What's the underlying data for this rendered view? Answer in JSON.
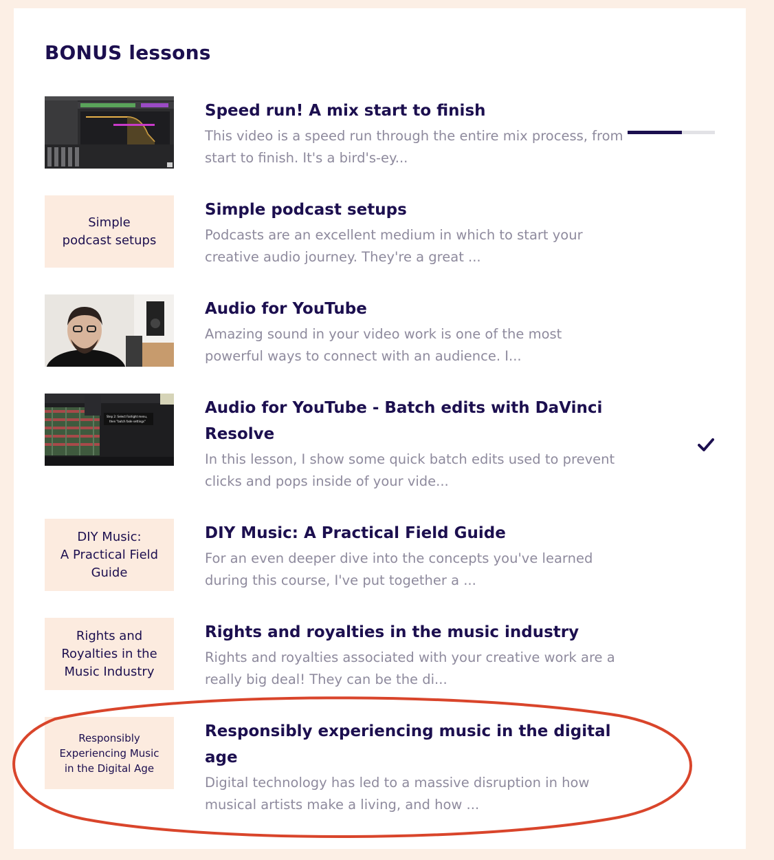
{
  "section": {
    "title": "BONUS lessons"
  },
  "lessons": [
    {
      "title": "Speed run! A mix start to finish",
      "description": "This video is a speed run through the entire mix process, from start to finish.  It's a bird's-ey...",
      "thumbnail_type": "daw-screenshot",
      "progress": 0.62
    },
    {
      "title": "Simple podcast setups",
      "description": "Podcasts are an excellent medium in which to start your creative audio journey.  They're a great ...",
      "thumbnail_text": "Simple\npodcast setups"
    },
    {
      "title": "Audio for YouTube",
      "description": "Amazing sound in your video work is one of the most powerful ways to connect with an audience.  I...",
      "thumbnail_type": "webcam-photo"
    },
    {
      "title": "Audio for YouTube - Batch edits with DaVinci Resolve",
      "description": "In this lesson, I show some quick batch edits used to prevent clicks and pops inside of your vide...",
      "thumbnail_type": "davinci-screenshot",
      "thumbnail_caption": "Step 2: Select Fairlight menu, then \"batch fade settings\"",
      "completed": true,
      "status_icon": "checkmark-icon"
    },
    {
      "title": "DIY Music: A Practical Field Guide",
      "description": "For an even deeper dive into the concepts you've learned during this course, I've put together a ...",
      "thumbnail_text": "DIY Music:\nA Practical Field\nGuide"
    },
    {
      "title": "Rights and royalties in the music industry",
      "description": "Rights and royalties associated with your creative work are a really big deal! They can be the di...",
      "thumbnail_text": "Rights and\nRoyalties in the\nMusic Industry"
    },
    {
      "title": "Responsibly experiencing music in the digital age",
      "description": "Digital technology has led to a massive disruption in how musical artists make a living, and how ...",
      "thumbnail_text": "Responsibly\nExperiencing Music\nin the Digital Age",
      "highlighted": true
    }
  ],
  "colors": {
    "page_background": "#fcefe5",
    "card_background": "#ffffff",
    "title_color": "#1c0f4f",
    "description_color": "#8e8a9d",
    "thumbnail_background": "#fcebdf",
    "highlight_annotation": "#d9452b"
  }
}
